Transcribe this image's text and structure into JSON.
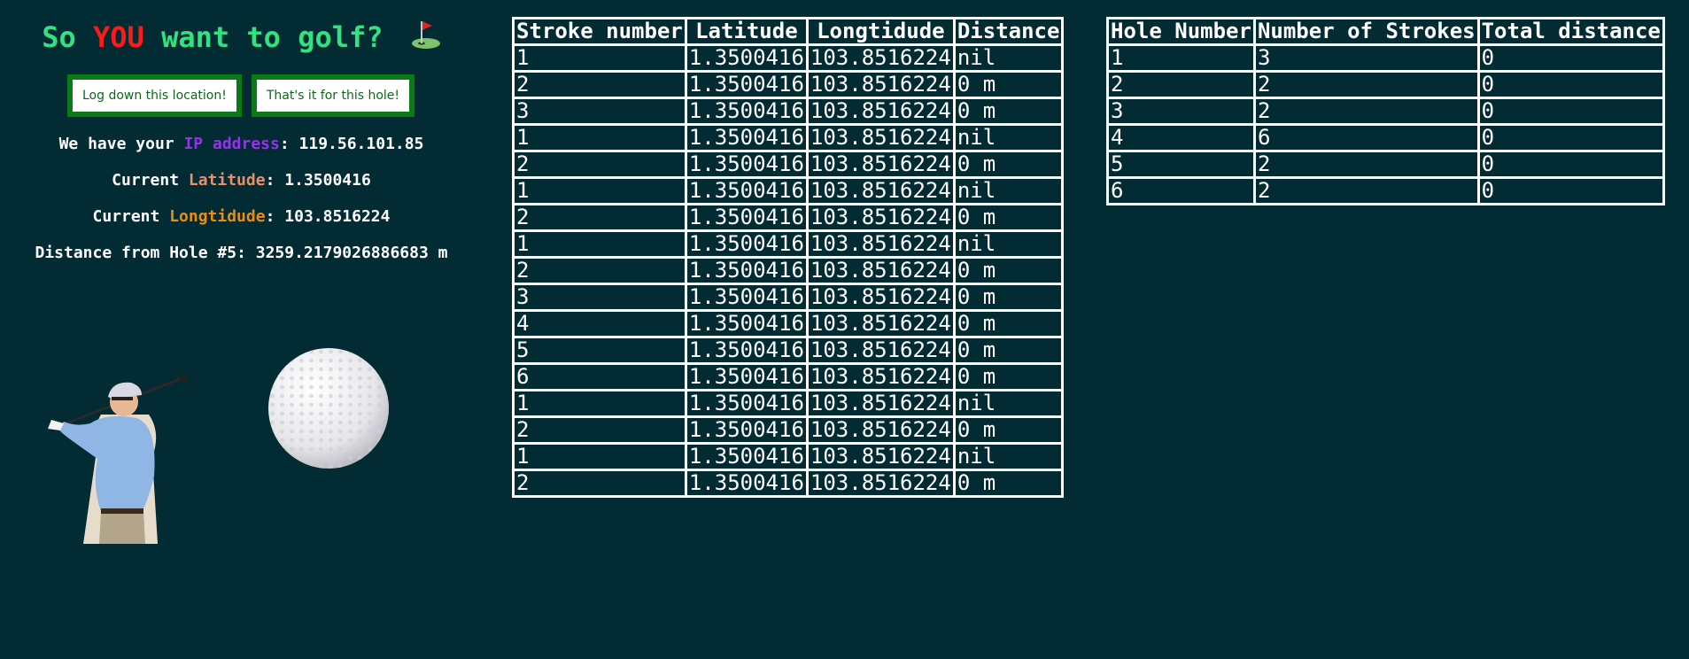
{
  "title": {
    "part1": "So ",
    "part2": "YOU",
    "part3": " want to golf?",
    "flag_icon": "golf-flag-icon"
  },
  "buttons": {
    "log_location": "Log down this location!",
    "end_hole": "That's it for this hole!"
  },
  "info": {
    "ip_prefix": "We have your ",
    "ip_label": "IP address",
    "ip_sep": ": ",
    "ip_value": "119.56.101.85",
    "lat_prefix": "Current ",
    "lat_label": "Latitude",
    "lat_sep": ": ",
    "lat_value": "1.3500416",
    "lng_prefix": "Current ",
    "lng_label": "Longtidude",
    "lng_sep": ": ",
    "lng_value": "103.8516224",
    "distance_line": "Distance from Hole #5: 3259.2179026886683 m"
  },
  "colors": {
    "background": "#022b33",
    "title": "#34e07f",
    "you": "#ff1a1a",
    "ip_label": "#9a2ff0",
    "lat_label": "#e9906a",
    "lng_label": "#ee8c12",
    "button_border": "#0a7a18"
  },
  "strokes_table": {
    "headers": [
      "Stroke number",
      "Latitude",
      "Longtidude",
      "Distance"
    ],
    "rows": [
      [
        "1",
        "1.3500416",
        "103.8516224",
        "nil"
      ],
      [
        "2",
        "1.3500416",
        "103.8516224",
        "0 m"
      ],
      [
        "3",
        "1.3500416",
        "103.8516224",
        "0 m"
      ],
      [
        "1",
        "1.3500416",
        "103.8516224",
        "nil"
      ],
      [
        "2",
        "1.3500416",
        "103.8516224",
        "0 m"
      ],
      [
        "1",
        "1.3500416",
        "103.8516224",
        "nil"
      ],
      [
        "2",
        "1.3500416",
        "103.8516224",
        "0 m"
      ],
      [
        "1",
        "1.3500416",
        "103.8516224",
        "nil"
      ],
      [
        "2",
        "1.3500416",
        "103.8516224",
        "0 m"
      ],
      [
        "3",
        "1.3500416",
        "103.8516224",
        "0 m"
      ],
      [
        "4",
        "1.3500416",
        "103.8516224",
        "0 m"
      ],
      [
        "5",
        "1.3500416",
        "103.8516224",
        "0 m"
      ],
      [
        "6",
        "1.3500416",
        "103.8516224",
        "0 m"
      ],
      [
        "1",
        "1.3500416",
        "103.8516224",
        "nil"
      ],
      [
        "2",
        "1.3500416",
        "103.8516224",
        "0 m"
      ],
      [
        "1",
        "1.3500416",
        "103.8516224",
        "nil"
      ],
      [
        "2",
        "1.3500416",
        "103.8516224",
        "0 m"
      ]
    ]
  },
  "holes_table": {
    "headers": [
      "Hole Number",
      "Number of Strokes",
      "Total distance"
    ],
    "rows": [
      [
        "1",
        "3",
        "0"
      ],
      [
        "2",
        "2",
        "0"
      ],
      [
        "3",
        "2",
        "0"
      ],
      [
        "4",
        "6",
        "0"
      ],
      [
        "5",
        "2",
        "0"
      ],
      [
        "6",
        "2",
        "0"
      ]
    ]
  },
  "images": {
    "golfer": "golfer-image",
    "ball": "golf-ball-image"
  }
}
